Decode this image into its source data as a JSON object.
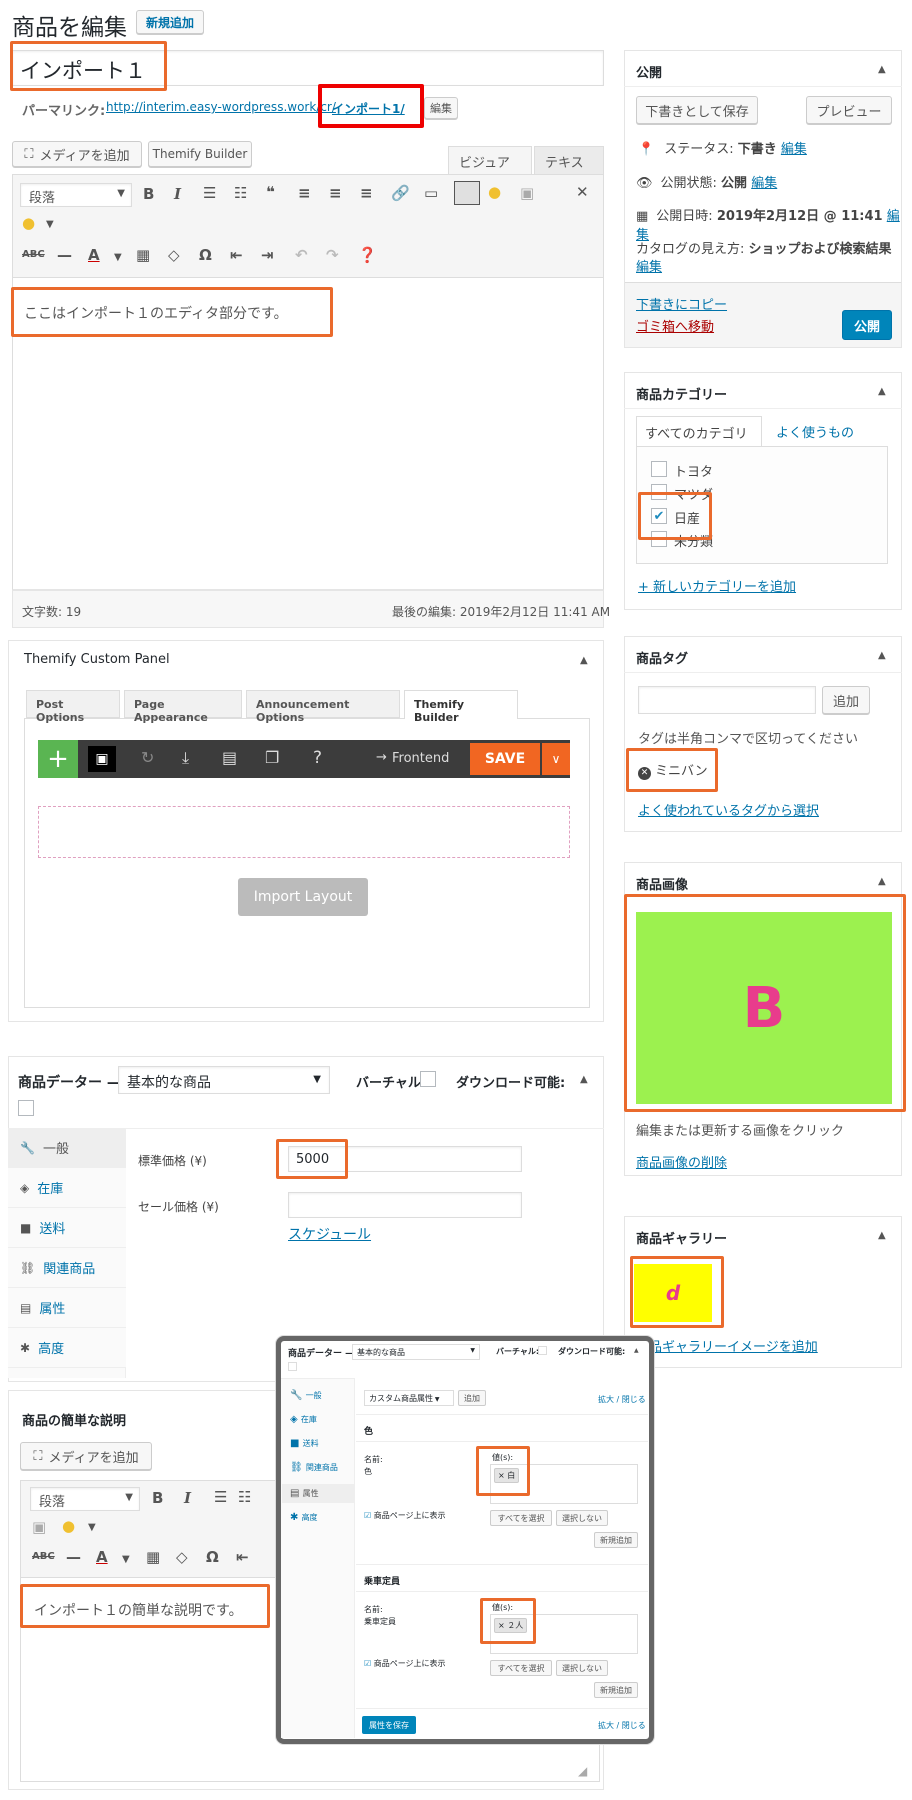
{
  "header": {
    "title": "商品を編集",
    "add_new": "新規追加"
  },
  "post": {
    "title": "インポート１",
    "permalink_label": "パーマリンク:",
    "permalink_url": "http://interim.easy-wordpress.work/cr/",
    "permalink_slug": "インポート1/",
    "edit": "編集"
  },
  "editor": {
    "add_media": "メディアを追加",
    "themify_builder": "Themify Builder",
    "tab_visual": "ビジュアル",
    "tab_text": "テキスト",
    "format": "段落",
    "content": "ここはインポート１のエディタ部分です。",
    "word_count": "文字数: 19",
    "last_edit": "最後の編集: 2019年2月12日 11:41 AM"
  },
  "themify": {
    "title": "Themify Custom Panel",
    "tabs": [
      "Post Options",
      "Page Appearance",
      "Announcement Options",
      "Themify Builder"
    ],
    "frontend": "Frontend",
    "save": "SAVE",
    "help": "?",
    "import_layout": "Import Layout"
  },
  "product_data": {
    "label": "商品データー —",
    "type": "基本的な商品",
    "virtual": "バーチャル:",
    "downloadable": "ダウンロード可能:",
    "tabs": [
      "一般",
      "在庫",
      "送料",
      "関連商品",
      "属性",
      "高度"
    ],
    "regular_price_label": "標準価格 (¥)",
    "regular_price": "5000",
    "sale_price_label": "セール価格 (¥)",
    "schedule": "スケジュール"
  },
  "short_desc": {
    "title": "商品の簡単な説明",
    "add_media": "メディアを追加",
    "format": "段落",
    "content": "インポート１の簡単な説明です。"
  },
  "publish": {
    "title": "公開",
    "save_draft": "下書きとして保存",
    "preview": "プレビュー",
    "status_label": "ステータス:",
    "status": "下書き",
    "visibility_label": "公開状態:",
    "visibility": "公開",
    "date_label": "公開日時:",
    "date": "2019年2月12日 @ 11:41",
    "catalog_label": "カタログの見え方:",
    "catalog": "ショップおよび検索結果",
    "edit": "編集",
    "copy_draft": "下書きにコピー",
    "trash": "ゴミ箱へ移動",
    "publish_btn": "公開"
  },
  "categories": {
    "title": "商品カテゴリー",
    "tab_all": "すべてのカテゴリー",
    "tab_popular": "よく使うもの",
    "items": [
      {
        "label": "トヨタ",
        "checked": false
      },
      {
        "label": "マツダ",
        "checked": false
      },
      {
        "label": "日産",
        "checked": true
      },
      {
        "label": "未分類",
        "checked": false
      }
    ],
    "add_new": "+ 新しいカテゴリーを追加"
  },
  "tags": {
    "title": "商品タグ",
    "add": "追加",
    "hint": "タグは半角コンマで区切ってください",
    "tag": "ミニバン",
    "choose": "よく使われているタグから選択"
  },
  "product_image": {
    "title": "商品画像",
    "letter": "B",
    "hint": "編集または更新する画像をクリック",
    "remove": "商品画像の削除",
    "color": "#9cf14f",
    "letter_color": "#e83c8c"
  },
  "gallery": {
    "title": "商品ギャラリー",
    "letter": "d",
    "add": "商品ギャラリーイメージを追加",
    "color": "#ffff00"
  },
  "popup": {
    "label": "商品データー —",
    "type": "基本的な商品",
    "virtual": "バーチャル:",
    "downloadable": "ダウンロード可能:",
    "tabs": [
      "一般",
      "在庫",
      "送料",
      "関連商品",
      "属性",
      "高度"
    ],
    "custom_attr": "カスタム商品属性",
    "add": "追加",
    "expand": "拡大 / 閉じる",
    "attr1_title": "色",
    "attr1_name_label": "名前:",
    "attr1_name": "色",
    "attr1_values_label": "値(s):",
    "attr1_value": "× 白",
    "attr2_title": "乗車定員",
    "attr2_name_label": "名前:",
    "attr2_name": "乗車定員",
    "attr2_values_label": "値(s):",
    "attr2_value": "× ２人",
    "show_on_page": "商品ページ上に表示",
    "select_all": "すべてを選択",
    "select_none": "選択しない",
    "add_new": "新規追加",
    "save_attrs": "属性を保存"
  }
}
